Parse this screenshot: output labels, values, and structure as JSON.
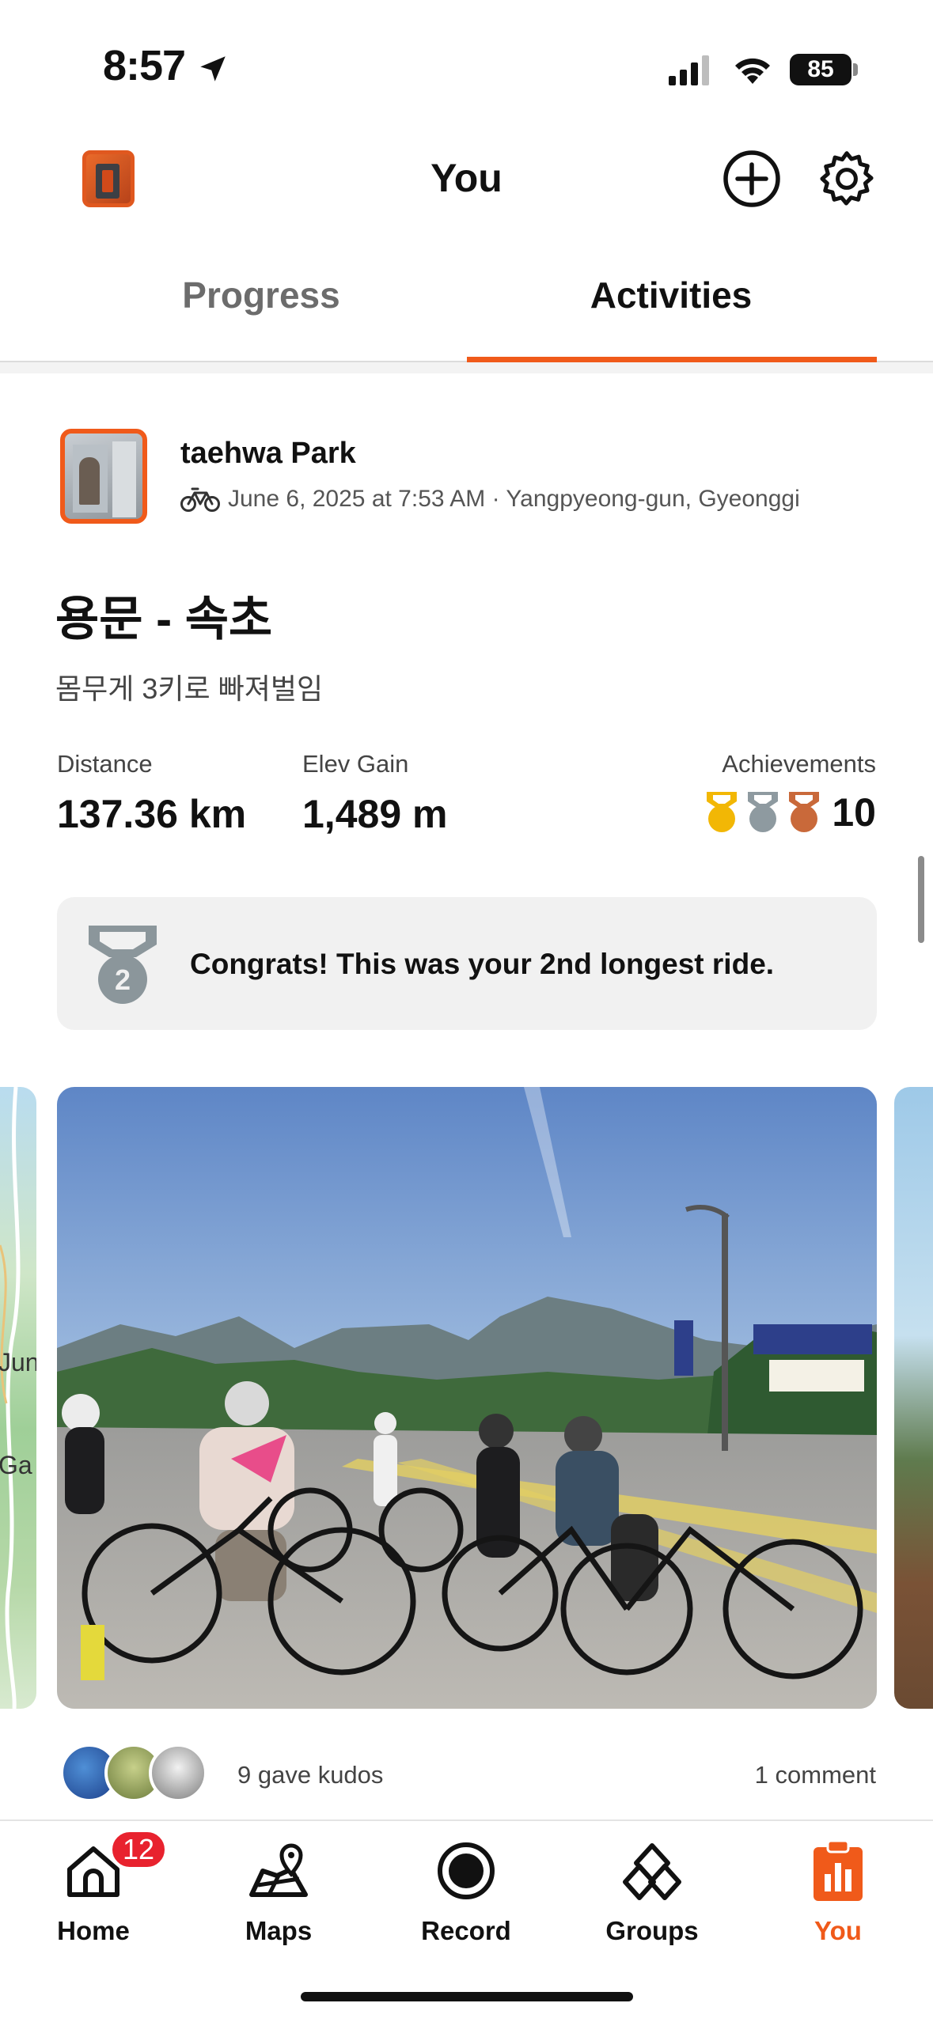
{
  "status_bar": {
    "time": "8:57",
    "battery": "85"
  },
  "header": {
    "title": "You"
  },
  "tabs": [
    {
      "label": "Progress",
      "active": false
    },
    {
      "label": "Activities",
      "active": true
    }
  ],
  "activity": {
    "athlete_name": "taehwa Park",
    "meta": "June 6, 2025 at 7:53 AM · Yangpyeong-gun, Gyeonggi",
    "title": "용문 - 속초",
    "description": "몸무게 3키로 빠져벌임",
    "stats": {
      "distance_label": "Distance",
      "distance_value": "137.36 km",
      "elev_label": "Elev Gain",
      "elev_value": "1,489 m",
      "achievements_label": "Achievements",
      "achievements_count": "10"
    },
    "congrats_text": "Congrats! This was your 2nd longest ride.",
    "congrats_medal_number": "2",
    "map_labels": [
      "Jun",
      "Ga"
    ],
    "kudos_text": "9 gave kudos",
    "comment_text": "1 comment"
  },
  "nav": {
    "home": "Home",
    "home_badge": "12",
    "maps": "Maps",
    "record": "Record",
    "groups": "Groups",
    "you": "You"
  },
  "colors": {
    "accent": "#f05a1a",
    "gold": "#f2b705",
    "silver": "#8e9aa0",
    "bronze": "#c9693a"
  }
}
